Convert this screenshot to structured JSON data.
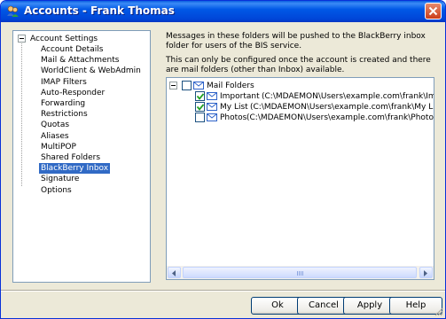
{
  "window": {
    "title": "Accounts - Frank Thomas"
  },
  "tree": {
    "root_label": "Account Settings",
    "items": [
      {
        "label": "Account Details"
      },
      {
        "label": "Mail & Attachments"
      },
      {
        "label": "WorldClient & WebAdmin"
      },
      {
        "label": "IMAP Filters"
      },
      {
        "label": "Auto-Responder"
      },
      {
        "label": "Forwarding"
      },
      {
        "label": "Restrictions"
      },
      {
        "label": "Quotas"
      },
      {
        "label": "Aliases"
      },
      {
        "label": "MultiPOP"
      },
      {
        "label": "Shared Folders"
      },
      {
        "label": "BlackBerry Inbox",
        "selected": true
      },
      {
        "label": "Signature"
      },
      {
        "label": "Options"
      }
    ]
  },
  "description": {
    "line1": "Messages in these folders will be pushed to the BlackBerry inbox folder for users of the BIS service.",
    "line2": "This can only be configured once the account is created and there are mail folders (other than Inbox) available."
  },
  "folders": {
    "root": {
      "label": "Mail Folders",
      "checked": false
    },
    "items": [
      {
        "name": "Important",
        "path": "(C:\\MDAEMON\\Users\\example.com\\frank\\Important)",
        "checked": true
      },
      {
        "name": "My List",
        "path": "(C:\\MDAEMON\\Users\\example.com\\frank\\My List)",
        "checked": true
      },
      {
        "name": "Photos",
        "path": "(C:\\MDAEMON\\Users\\example.com\\frank\\Photos)",
        "checked": false
      }
    ]
  },
  "buttons": {
    "ok": "Ok",
    "cancel": "Cancel",
    "apply": "Apply",
    "help": "Help"
  },
  "colors": {
    "titlebar": "#0054e3",
    "selection": "#316ac5",
    "dialog_bg": "#ece9d8"
  }
}
